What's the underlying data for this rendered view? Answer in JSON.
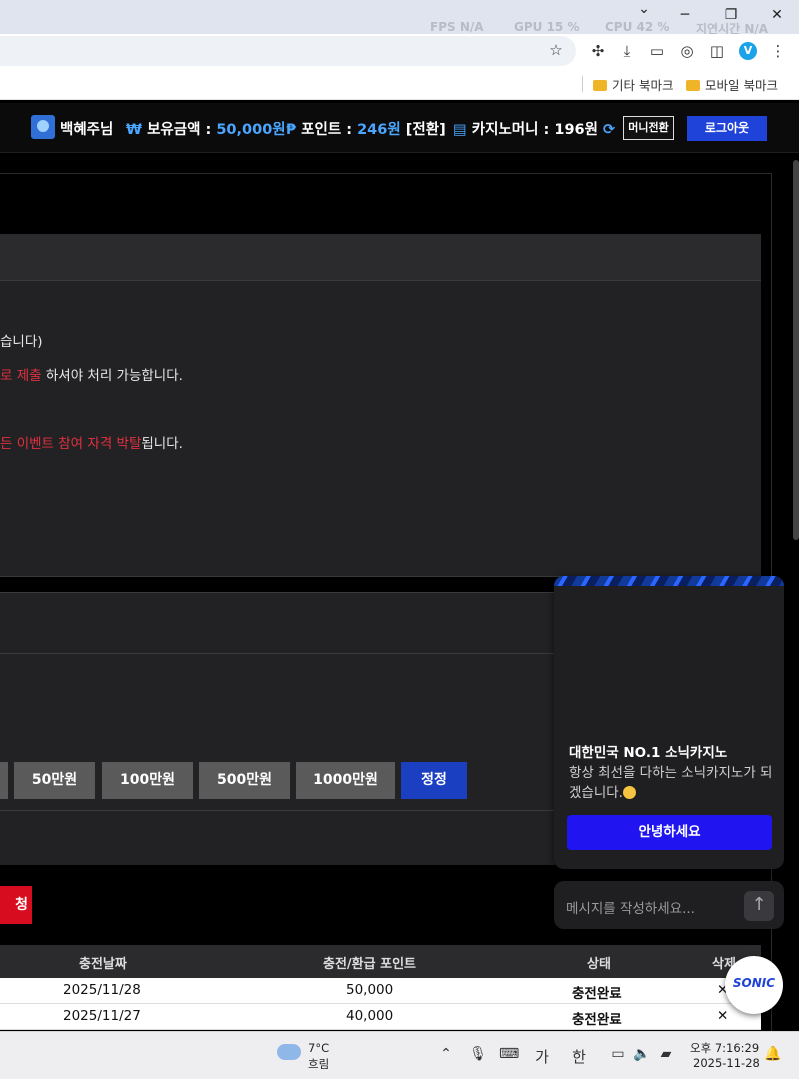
{
  "browser": {
    "perf": {
      "fps": "FPS  N/A",
      "gpu": "GPU  15 %",
      "cpu": "CPU  42 %",
      "latency": "지연시간  N/A"
    },
    "window_controls": {
      "minimize": "─",
      "restore": "❐",
      "close": "✕",
      "tabs": "⌄"
    },
    "bookmarks": [
      {
        "label": "기타 북마크"
      },
      {
        "label": "모바일 북마크"
      }
    ],
    "profile_initial": "V"
  },
  "header": {
    "username": "백혜주님",
    "balance_label": "보유금액 :",
    "balance_value": "50,000원",
    "point_label": "포인트 :",
    "point_value": "246원",
    "convert_label": "[전환]",
    "casino_label": "카지노머니 :",
    "casino_value": "196원",
    "money_convert": "머니전환",
    "logout": "로그아웃",
    "won_symbol": "₩",
    "point_symbol": "₱"
  },
  "notice": {
    "line1": "습니다)",
    "line2_red": "로 제출",
    "line2_rest": " 하셔야 처리 가능합니다.",
    "line3_red": "든 이벤트 참여 자격 박탈",
    "line3_rest": "됩니다."
  },
  "amount_buttons": [
    {
      "label": "50만원"
    },
    {
      "label": "100만원"
    },
    {
      "label": "500만원"
    },
    {
      "label": "1000만원"
    },
    {
      "label": "정정"
    }
  ],
  "apply_button": "청",
  "table": {
    "headers": [
      "충전날짜",
      "충전/환급 포인트",
      "상태",
      "삭제"
    ],
    "rows": [
      {
        "date": "2025/11/28",
        "points": "50,000",
        "status": "충전완료",
        "delete": "✕"
      },
      {
        "date": "2025/11/27",
        "points": "40,000",
        "status": "충전완료",
        "delete": "✕"
      }
    ]
  },
  "chat": {
    "title": "대한민국 NO.1 소닉카지노",
    "desc": "항상 최선을 다하는 소닉카지노가 되겠습니다.",
    "hello_button": "안녕하세요",
    "input_placeholder": "메시지를 작성하세요...",
    "send_icon": "↑",
    "launcher_logo": "SONIC"
  },
  "taskbar": {
    "temp": "7°C",
    "weather": "흐림",
    "ime1": "가",
    "ime2": "한",
    "time": "오후 7:16:29",
    "date": "2025-11-28"
  }
}
